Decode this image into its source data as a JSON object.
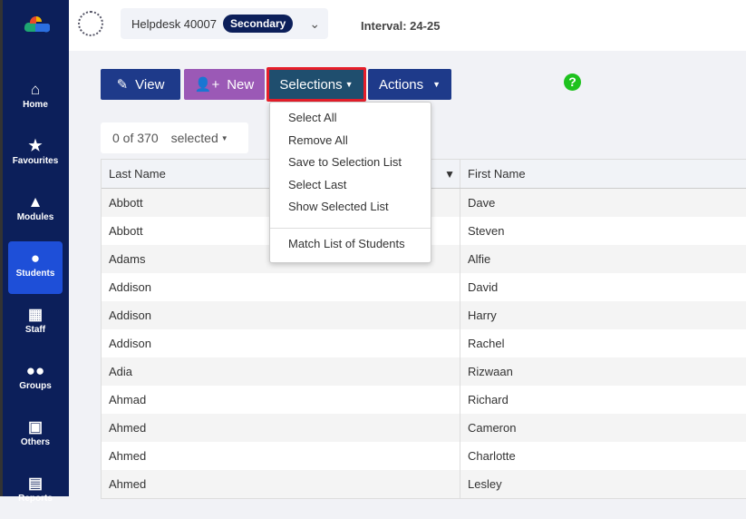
{
  "sidebar": {
    "items": [
      {
        "label": "Home",
        "icon": "home-icon",
        "glyph": "⌂"
      },
      {
        "label": "Favourites",
        "icon": "star-icon",
        "glyph": "★"
      },
      {
        "label": "Modules",
        "icon": "shapes-icon",
        "glyph": "▲"
      },
      {
        "label": "Students",
        "icon": "user-icon",
        "glyph": "●",
        "active": true
      },
      {
        "label": "Staff",
        "icon": "staff-board-icon",
        "glyph": "▦"
      },
      {
        "label": "Groups",
        "icon": "users-icon",
        "glyph": "●●"
      },
      {
        "label": "Others",
        "icon": "presentation-icon",
        "glyph": "▣"
      },
      {
        "label": "Reports",
        "icon": "file-icon",
        "glyph": "▤"
      }
    ]
  },
  "header": {
    "school": "Helpdesk 40007",
    "badge": "Secondary",
    "interval": "Interval: 24-25"
  },
  "toolbar": {
    "view": "View",
    "new": "New",
    "selections": "Selections",
    "actions": "Actions",
    "help": "?"
  },
  "selection": {
    "count": "0 of 370",
    "label": "selected"
  },
  "menu": {
    "items": [
      "Select All",
      "Remove All",
      "Save to Selection List",
      "Select Last",
      "Show Selected List"
    ],
    "extra": "Match List of Students"
  },
  "table": {
    "columns": [
      "Last Name",
      "First Name"
    ],
    "rows": [
      [
        "Abbott",
        "Dave"
      ],
      [
        "Abbott",
        "Steven"
      ],
      [
        "Adams",
        "Alfie"
      ],
      [
        "Addison",
        "David"
      ],
      [
        "Addison",
        "Harry"
      ],
      [
        "Addison",
        "Rachel"
      ],
      [
        "Adia",
        "Rizwaan"
      ],
      [
        "Ahmad",
        "Richard"
      ],
      [
        "Ahmed",
        "Cameron"
      ],
      [
        "Ahmed",
        "Charlotte"
      ],
      [
        "Ahmed",
        "Lesley"
      ]
    ]
  },
  "colors": {
    "sidebar": "#0c1f5a",
    "active": "#1e4fd8",
    "primary": "#1e3a8a",
    "new": "#9b59b6",
    "selections": "#1f4e6e",
    "highlight": "#e61e2a"
  }
}
